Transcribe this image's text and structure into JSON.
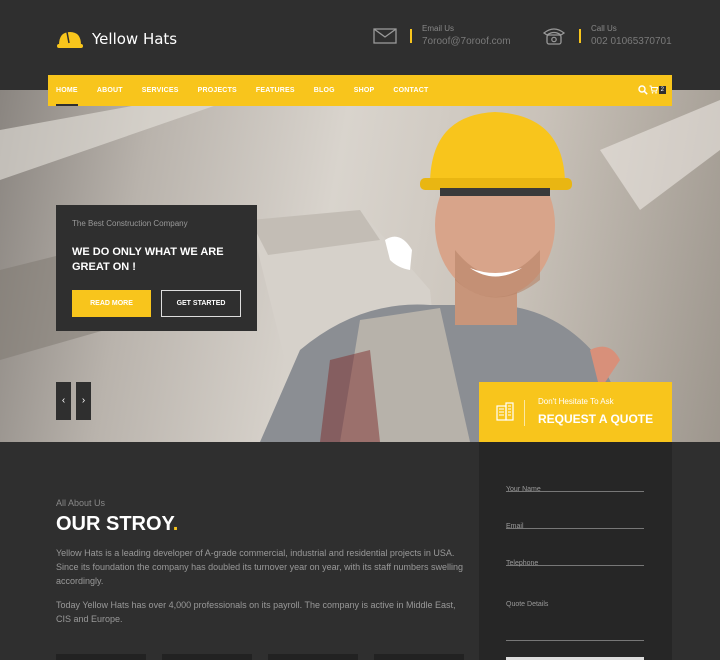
{
  "header": {
    "brand": "Yellow Hats",
    "email": {
      "label": "Email Us",
      "value": "7oroof@7oroof.com"
    },
    "call": {
      "label": "Call Us",
      "value": "002 01065370701"
    }
  },
  "nav": {
    "items": [
      "HOME",
      "ABOUT",
      "SERVICES",
      "PROJECTS",
      "FEATURES",
      "BLOG",
      "SHOP",
      "CONTACT"
    ],
    "cart_count": "2"
  },
  "hero": {
    "kicker": "The Best Construction Company",
    "title": "WE DO ONLY WHAT WE ARE GREAT ON !",
    "read_more": "READ MORE",
    "get_started": "GET STARTED",
    "prev": "‹",
    "next": "›"
  },
  "quote": {
    "small": "Don't Hesitate To Ask",
    "big": "REQUEST A QUOTE",
    "fields": [
      "Your Name",
      "Email",
      "Telephone",
      "Quote Details"
    ]
  },
  "about": {
    "kicker": "All About Us",
    "title": "OUR STROY",
    "dot": ".",
    "p1": "Yellow Hats is a leading developer of A-grade commercial, industrial and residential projects in USA. Since its foundation the company has doubled its turnover year on year, with its staff numbers swelling accordingly.",
    "p2": "Today Yellow Hats has over 4,000 professionals on its payroll. The company is active in Middle East, CIS and Europe."
  },
  "colors": {
    "accent": "#f8c51c",
    "dark": "#2f2f2f"
  }
}
